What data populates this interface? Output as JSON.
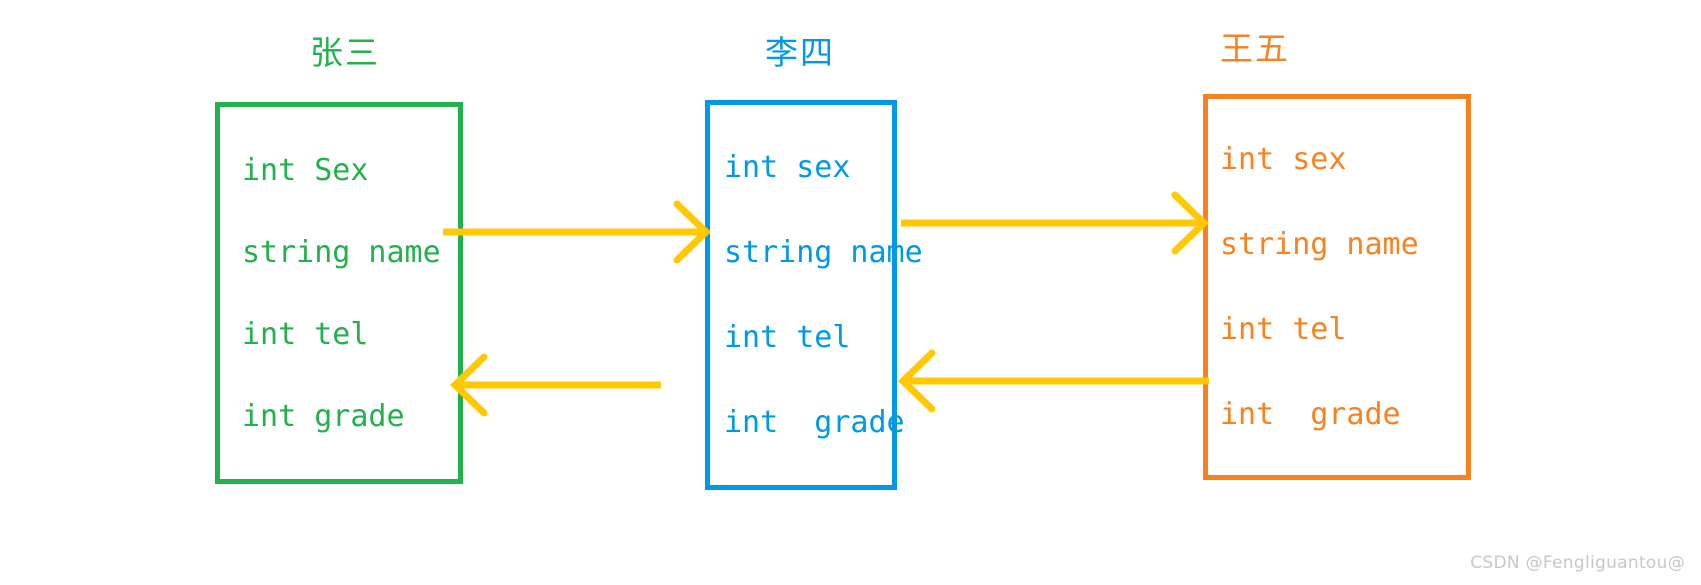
{
  "diagram": {
    "title": "class member sharing diagram",
    "background_color": "#ffffff",
    "arrow_color": "#FFC800",
    "entities": [
      {
        "id": "zhangsan",
        "name": "张三",
        "color": "#22B14C",
        "fields": [
          "int Sex",
          "string name",
          "int tel",
          "int grade"
        ]
      },
      {
        "id": "lisi",
        "name": "李四",
        "color": "#0099E5",
        "fields": [
          "int sex",
          "string name",
          "int tel",
          "int  grade"
        ]
      },
      {
        "id": "wangwu",
        "name": "王五",
        "color": "#F8821F",
        "fields": [
          "int sex",
          "string name",
          "int tel",
          "int  grade"
        ]
      }
    ],
    "arrows": [
      {
        "id": "zhangsan-to-lisi",
        "direction": "right",
        "from": "zhangsan",
        "to": "lisi",
        "color": "#FFC800"
      },
      {
        "id": "lisi-to-wangwu",
        "direction": "right",
        "from": "lisi",
        "to": "wangwu",
        "color": "#FFC800"
      },
      {
        "id": "lisi-to-zhangsan",
        "direction": "left",
        "from": "lisi",
        "to": "zhangsan",
        "color": "#FFC800"
      },
      {
        "id": "wangwu-to-lisi",
        "direction": "left",
        "from": "wangwu",
        "to": "lisi",
        "color": "#FFC800"
      }
    ]
  },
  "watermark": {
    "text": "CSDN @Fengliguantou@",
    "color": "#c7c7c7"
  }
}
